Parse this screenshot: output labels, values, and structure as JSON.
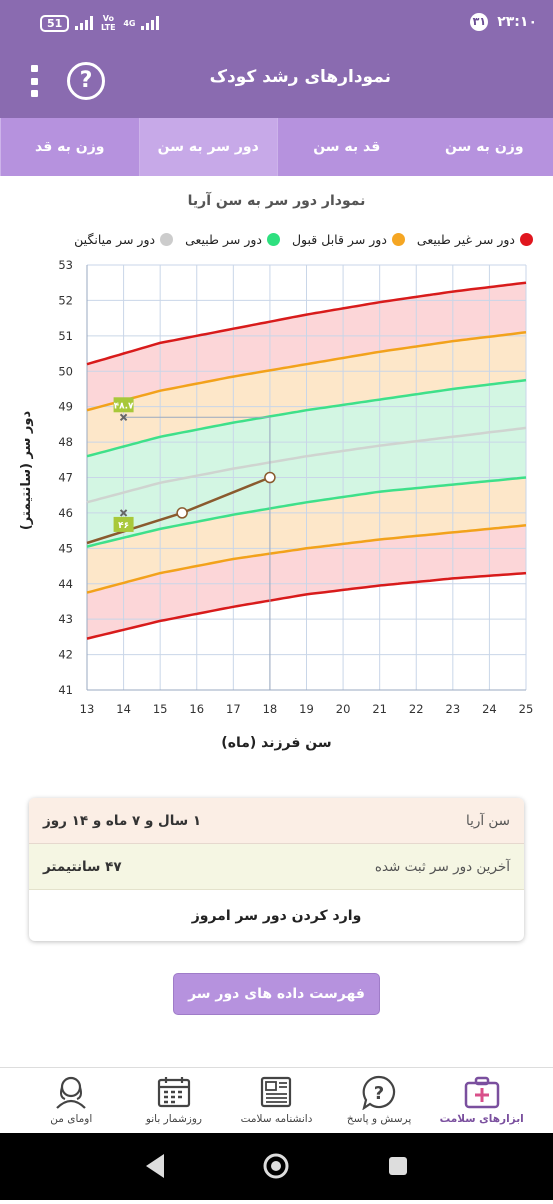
{
  "status_bar": {
    "time": "۲۳:۱۰",
    "notification_count": "۳۱",
    "battery": "51",
    "network": "4G",
    "volte": "Vo LTE"
  },
  "app_bar": {
    "title": "نمودارهای رشد کودک",
    "help_label": "?"
  },
  "tabs": [
    {
      "label": "وزن به سن",
      "active": false
    },
    {
      "label": "قد به سن",
      "active": false
    },
    {
      "label": "دور سر به سن",
      "active": true
    },
    {
      "label": "وزن به قد",
      "active": false
    }
  ],
  "chart_title": "نمودار دور سر به سن آریا",
  "legend": [
    {
      "label": "دور سر غیر طبیعی",
      "color": "#e0161e"
    },
    {
      "label": "دور سر قابل قبول",
      "color": "#f5a623"
    },
    {
      "label": "دور سر طبیعی",
      "color": "#2ee07f"
    },
    {
      "label": "دور سر میانگین",
      "color": "#cccccc"
    }
  ],
  "chart_data": {
    "type": "line",
    "xlabel": "سن فرزند (ماه)",
    "ylabel": "دور سر (سانتیمتر)",
    "xlim": [
      13,
      25
    ],
    "ylim": [
      41,
      53
    ],
    "x_ticks": [
      "13",
      "14",
      "15",
      "16",
      "17",
      "18",
      "19",
      "20",
      "21",
      "22",
      "23",
      "24",
      "25"
    ],
    "y_ticks": [
      "41",
      "42",
      "43",
      "44",
      "45",
      "46",
      "47",
      "48",
      "49",
      "50",
      "51",
      "52",
      "53"
    ],
    "grid": true,
    "series": [
      {
        "name": "دور سر غیر طبیعی",
        "kind": "upper-red",
        "x": [
          13,
          15,
          17,
          19,
          21,
          23,
          25
        ],
        "values": [
          50.2,
          50.8,
          51.2,
          51.6,
          51.95,
          52.25,
          52.5
        ]
      },
      {
        "name": "دور سر قابل قبول",
        "kind": "upper-orange",
        "x": [
          13,
          15,
          17,
          19,
          21,
          23,
          25
        ],
        "values": [
          48.9,
          49.45,
          49.85,
          50.2,
          50.55,
          50.85,
          51.1
        ]
      },
      {
        "name": "دور سر طبیعی",
        "kind": "upper-green",
        "x": [
          13,
          15,
          17,
          19,
          21,
          23,
          25
        ],
        "values": [
          47.6,
          48.15,
          48.55,
          48.9,
          49.2,
          49.5,
          49.75
        ]
      },
      {
        "name": "دور سر میانگین",
        "kind": "mean",
        "x": [
          13,
          15,
          17,
          19,
          21,
          23,
          25
        ],
        "values": [
          46.3,
          46.85,
          47.25,
          47.6,
          47.9,
          48.15,
          48.4
        ]
      },
      {
        "name": "دور سر طبیعی",
        "kind": "lower-green",
        "x": [
          13,
          15,
          17,
          19,
          21,
          23,
          25
        ],
        "values": [
          45.05,
          45.55,
          45.95,
          46.3,
          46.6,
          46.8,
          47.0
        ]
      },
      {
        "name": "دور سر قابل قبول",
        "kind": "lower-orange",
        "x": [
          13,
          15,
          17,
          19,
          21,
          23,
          25
        ],
        "values": [
          43.75,
          44.3,
          44.7,
          45.0,
          45.25,
          45.45,
          45.65
        ]
      },
      {
        "name": "دور سر غیر طبیعی",
        "kind": "lower-red",
        "x": [
          13,
          15,
          17,
          19,
          21,
          23,
          25
        ],
        "values": [
          42.45,
          42.95,
          43.35,
          43.7,
          43.95,
          44.15,
          44.3
        ]
      }
    ],
    "child": {
      "x": [
        13,
        15.6,
        18
      ],
      "values": [
        45.15,
        46.0,
        47.0
      ]
    },
    "markers": [
      {
        "x": 14,
        "y": 48.7,
        "label": "۴۸.۷"
      },
      {
        "x": 14,
        "y": 46.0,
        "label": "۴۶"
      }
    ]
  },
  "info": {
    "age_label": "سن آریا",
    "age_value": "۱ سال و ۷ ماه و ۱۴ روز",
    "last_label": "آخرین دور سر ثبت شده",
    "last_value": "۴۷ سانتیمتر",
    "enter_label": "وارد کردن دور سر امروز"
  },
  "list_button": "فهرست داده های دور سر آریا",
  "bottom_nav": [
    {
      "label": "ابزارهای سلامت",
      "icon": "health-kit-icon",
      "active": true
    },
    {
      "label": "پرسش و پاسخ",
      "icon": "question-icon",
      "active": false
    },
    {
      "label": "دانشنامه سلامت",
      "icon": "encyclopedia-icon",
      "active": false
    },
    {
      "label": "روزشمار بانو",
      "icon": "calendar-icon",
      "active": false
    },
    {
      "label": "اومای من",
      "icon": "profile-icon",
      "active": false
    }
  ]
}
